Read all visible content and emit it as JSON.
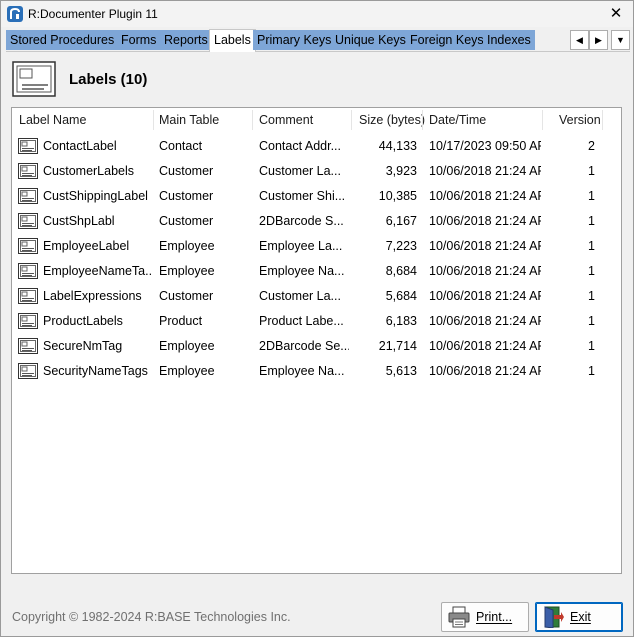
{
  "window": {
    "title": "R:Documenter Plugin 11",
    "close_label": "✕"
  },
  "tabs": [
    {
      "label": "Stored Procedures",
      "active": false
    },
    {
      "label": "Forms",
      "active": false
    },
    {
      "label": "Reports",
      "active": false
    },
    {
      "label": "Labels",
      "active": true
    },
    {
      "label": "Primary Keys",
      "active": false
    },
    {
      "label": "Unique Keys",
      "active": false
    },
    {
      "label": "Foreign Keys",
      "active": false
    },
    {
      "label": "Indexes",
      "active": false
    }
  ],
  "tab_nav": {
    "prev": "◀",
    "next": "▶",
    "menu": "▼"
  },
  "page": {
    "title": "Labels (10)"
  },
  "columns": {
    "name": "Label Name",
    "table": "Main Table",
    "comment": "Comment",
    "size": "Size (bytes)",
    "date": "Date/Time",
    "version": "Version"
  },
  "rows": [
    {
      "name": "ContactLabel",
      "table": "Contact",
      "comment": "Contact Addr...",
      "size": "44,133",
      "date": "10/17/2023 09:50 AP",
      "version": "2"
    },
    {
      "name": "CustomerLabels",
      "table": "Customer",
      "comment": "Customer La...",
      "size": "3,923",
      "date": "10/06/2018 21:24 AP",
      "version": "1"
    },
    {
      "name": "CustShippingLabel",
      "table": "Customer",
      "comment": "Customer Shi...",
      "size": "10,385",
      "date": "10/06/2018 21:24 AP",
      "version": "1"
    },
    {
      "name": "CustShpLabl",
      "table": "Customer",
      "comment": "2DBarcode S...",
      "size": "6,167",
      "date": "10/06/2018 21:24 AP",
      "version": "1"
    },
    {
      "name": "EmployeeLabel",
      "table": "Employee",
      "comment": "Employee La...",
      "size": "7,223",
      "date": "10/06/2018 21:24 AP",
      "version": "1"
    },
    {
      "name": "EmployeeNameTa...",
      "table": "Employee",
      "comment": "Employee Na...",
      "size": "8,684",
      "date": "10/06/2018 21:24 AP",
      "version": "1"
    },
    {
      "name": "LabelExpressions",
      "table": "Customer",
      "comment": "Customer La...",
      "size": "5,684",
      "date": "10/06/2018 21:24 AP",
      "version": "1"
    },
    {
      "name": "ProductLabels",
      "table": "Product",
      "comment": "Product Labe...",
      "size": "6,183",
      "date": "10/06/2018 21:24 AP",
      "version": "1"
    },
    {
      "name": "SecureNmTag",
      "table": "Employee",
      "comment": "2DBarcode Se...",
      "size": "21,714",
      "date": "10/06/2018 21:24 AP",
      "version": "1"
    },
    {
      "name": "SecurityNameTags",
      "table": "Employee",
      "comment": "Employee Na...",
      "size": "5,613",
      "date": "10/06/2018 21:24 AP",
      "version": "1"
    }
  ],
  "footer": {
    "copyright": "Copyright © 1982-2024 R:BASE Technologies Inc.",
    "print_label": "Print...",
    "exit_label": "Exit"
  },
  "icons": {
    "app": "rbase-logo-icon",
    "page": "label-sheet-icon",
    "row": "label-icon",
    "print": "printer-icon",
    "exit": "exit-door-icon"
  },
  "colors": {
    "tab_inactive": "#7ea6d7",
    "tab_active": "#ffffff",
    "focus_border": "#0067c0"
  }
}
